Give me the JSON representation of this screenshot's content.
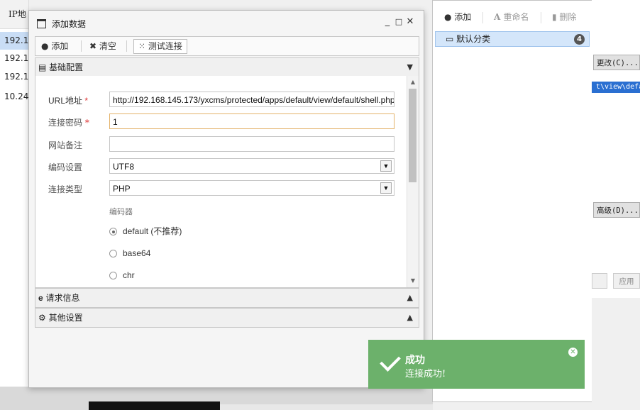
{
  "background_list": {
    "header": "IP地",
    "rows": [
      "192.1",
      "192.1",
      "192.1",
      "10.24"
    ]
  },
  "dialog": {
    "title": "添加数据",
    "controls": {
      "minimize": "_",
      "maximize": "□",
      "close": "✕"
    },
    "toolbar": {
      "add_icon": "●",
      "add_label": "添加",
      "clear_icon": "✖",
      "clear_label": "清空",
      "test_icon": "⁙",
      "test_label": "测试连接"
    },
    "basic_section": {
      "icon": "▤",
      "label": "基础配置",
      "chevron": "▼"
    },
    "form": {
      "url_label": "URL地址",
      "url_value": "http://192.168.145.173/yxcms/protected/apps/default/view/default/shell.php",
      "password_label": "连接密码",
      "password_value": "1",
      "note_label": "网站备注",
      "note_value": "",
      "encoding_label": "编码设置",
      "encoding_value": "UTF8",
      "type_label": "连接类型",
      "type_value": "PHP",
      "encoder_label": "编码器",
      "required_mark": "*",
      "encoders": [
        {
          "label": "default (不推荐)",
          "selected": true
        },
        {
          "label": "base64",
          "selected": false
        },
        {
          "label": "chr",
          "selected": false
        }
      ]
    },
    "request_section": {
      "icon": "e",
      "label": "请求信息",
      "chevron": "▲"
    },
    "other_section": {
      "icon": "⚙",
      "label": "其他设置",
      "chevron": "▲"
    }
  },
  "right_panel": {
    "add_label": "添加",
    "rename_label": "重命名",
    "delete_label": "删除",
    "category": {
      "label": "默认分类",
      "count": "4"
    }
  },
  "far_right": {
    "change_button": "更改(C)...",
    "path_text": "t\\view\\default",
    "advanced_button": "高级(D)...",
    "apply_button": "应用"
  },
  "toast": {
    "title": "成功",
    "message": "连接成功!",
    "close_icon": "✕",
    "color": "#6cb16b"
  }
}
